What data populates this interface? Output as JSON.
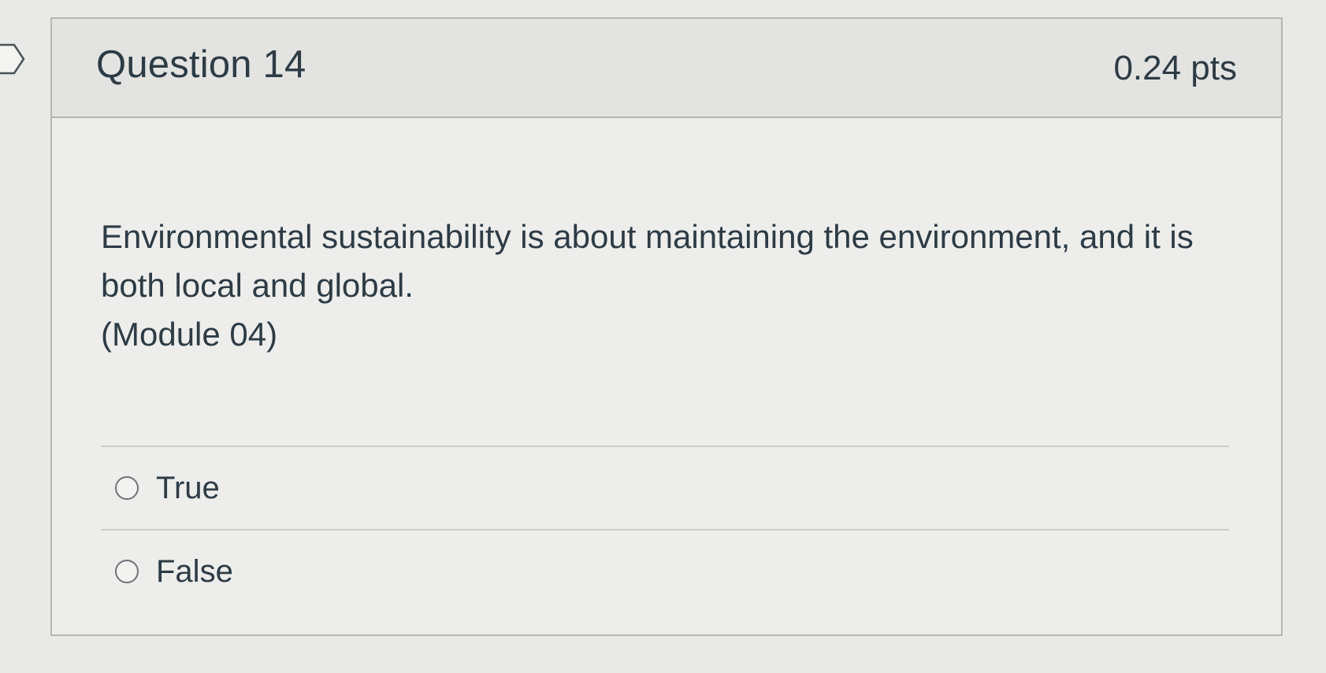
{
  "question": {
    "title": "Question 14",
    "points": "0.24 pts",
    "text_line1": "Environmental sustainability is about maintaining the environment, and it is both local and global.",
    "text_line2": "(Module 04)",
    "options": [
      {
        "label": "True",
        "selected": false
      },
      {
        "label": "False",
        "selected": false
      }
    ]
  },
  "colors": {
    "text": "#2d3b45",
    "border": "#b5b7b5",
    "header_bg": "#e3e3e1"
  },
  "icons": {
    "flag": "flag-outline-icon"
  }
}
